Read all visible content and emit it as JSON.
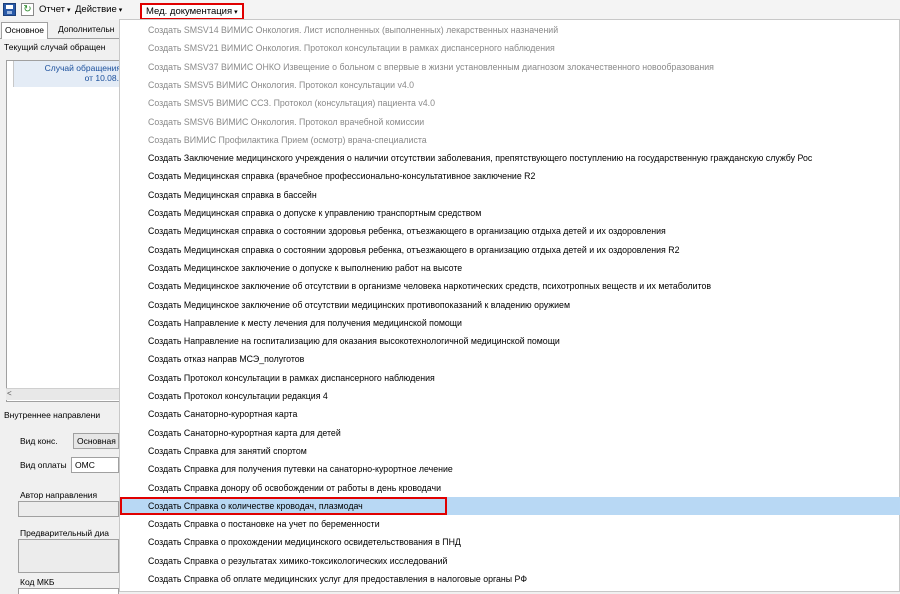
{
  "toolbar": {
    "report_label": "Отчет",
    "action_label": "Действие",
    "meddoc_label": "Мед. документация",
    "dropdown_arrow": "▾"
  },
  "left_panel": {
    "tab_main": "Основное",
    "tab_additional": "Дополнительн",
    "current_case_label": "Текущий случай обращен",
    "grid_header_line1": "Случай обращения",
    "grid_header_line2": "от 10.08.",
    "scroll_left": "<",
    "internal_referral_label": "Внутреннее направлени",
    "cons_type_label": "Вид конс.",
    "cons_type_value": "Основная",
    "payment_type_label": "Вид оплаты",
    "payment_type_value": "ОМС",
    "author_label": "Автор направления",
    "prelim_diag_label": "Предварительный диа",
    "mkb_label": "Код МКБ"
  },
  "menu": {
    "items": [
      {
        "label": "Создать SMSV14 ВИМИС  Онкология. Лист исполненных (выполненных) лекарственных назначений",
        "disabled": true
      },
      {
        "label": "Создать SMSV21 ВИМИС Онкология. Протокол консультации в рамках диспансерного наблюдения",
        "disabled": true
      },
      {
        "label": "Создать SMSV37 ВИМИС ОНКО Извещение о больном с впервые в жизни установленным диагнозом злокачественного новообразования",
        "disabled": true
      },
      {
        "label": "Создать SMSV5 ВИМИС Онкология. Протокол консультации v4.0",
        "disabled": true
      },
      {
        "label": "Создать SMSV5 ВИМИС ССЗ. Протокол (консультация) пациента v4.0",
        "disabled": true
      },
      {
        "label": "Создать SMSV6 ВИМИС Онкология. Протокол врачебной комиссии",
        "disabled": true
      },
      {
        "label": "Создать ВИМИС Профилактика Прием (осмотр) врача-специалиста",
        "disabled": true
      },
      {
        "label": "Создать Заключение медицинского учреждения о наличии отсутствии заболевания, препятствующего поступлению на государственную гражданскую службу Рос",
        "disabled": false
      },
      {
        "label": "Создать Медицинская справка (врачебное профессионально-консультативное заключение R2",
        "disabled": false
      },
      {
        "label": "Создать Медицинская справка в бассейн",
        "disabled": false
      },
      {
        "label": "Создать Медицинская справка о допуске к управлению транспортным средством",
        "disabled": false
      },
      {
        "label": "Создать Медицинская справка о состоянии здоровья ребенка, отъезжающего в организацию отдыха детей и их оздоровления",
        "disabled": false
      },
      {
        "label": "Создать Медицинская справка о состоянии здоровья ребенка, отъезжающего в организацию отдыха детей и их оздоровления R2",
        "disabled": false
      },
      {
        "label": "Создать Медицинское заключение о допуске к выполнению работ на высоте",
        "disabled": false
      },
      {
        "label": "Создать Медицинское заключение об отсутствии в организме человека наркотических средств, психотропных веществ и их метаболитов",
        "disabled": false
      },
      {
        "label": "Создать Медицинское заключение об отсутствии медицинских противопоказаний к владению оружием",
        "disabled": false
      },
      {
        "label": "Создать Направление к месту лечения для получения медицинской помощи",
        "disabled": false
      },
      {
        "label": "Создать Направление на госпитализацию для оказания высокотехнологичной медицинской помощи",
        "disabled": false
      },
      {
        "label": "Создать отказ направ МСЭ_полуготов",
        "disabled": false
      },
      {
        "label": "Создать Протокол консультации в рамках диспансерного наблюдения",
        "disabled": false
      },
      {
        "label": "Создать Протокол консультации редакция 4",
        "disabled": false
      },
      {
        "label": "Создать Санаторно-курортная карта",
        "disabled": false
      },
      {
        "label": "Создать Санаторно-курортная карта для детей",
        "disabled": false
      },
      {
        "label": "Создать Справка для занятий спортом",
        "disabled": false
      },
      {
        "label": "Создать Справка для получения путевки на санаторно-курортное лечение",
        "disabled": false
      },
      {
        "label": "Создать Справка донору об освобождении от работы в день кроводачи",
        "disabled": false
      },
      {
        "label": "Создать Справка о количестве кроводач, плазмодач",
        "disabled": false,
        "highlighted": true
      },
      {
        "label": "Создать Справка о постановке на учет по беременности",
        "disabled": false
      },
      {
        "label": "Создать Справка о прохождении медицинского освидетельствования в ПНД",
        "disabled": false
      },
      {
        "label": "Создать Справка о результатах химико-токсикологических исследований",
        "disabled": false
      },
      {
        "label": "Создать Справка об оплате медицинских услуг для предоставления в налоговые органы РФ",
        "disabled": false
      }
    ]
  }
}
